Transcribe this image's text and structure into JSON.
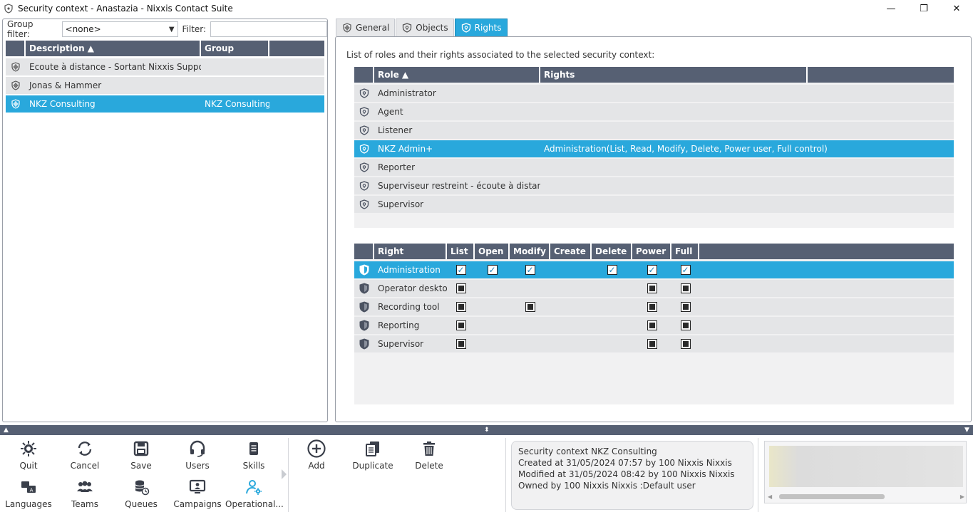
{
  "window": {
    "title": "Security context - Anastazia - Nixxis Contact Suite",
    "minimize": "—",
    "maximize": "❐",
    "close": "✕"
  },
  "left": {
    "group_filter_label": "Group filter:",
    "group_filter_value": "<none>",
    "filter_label": "Filter:",
    "filter_value": "",
    "columns": [
      "Description ▲",
      "Group"
    ],
    "rows": [
      {
        "description": "Ecoute à distance - Sortant Nixxis Support",
        "group": "",
        "selected": false
      },
      {
        "description": "Jonas & Hammer",
        "group": "",
        "selected": false
      },
      {
        "description": "NKZ Consulting",
        "group": "NKZ Consulting",
        "selected": true
      }
    ]
  },
  "tabs": [
    {
      "label": "General",
      "active": false
    },
    {
      "label": "Objects",
      "active": false
    },
    {
      "label": "Rights",
      "active": true
    }
  ],
  "rights_tab": {
    "description": "List of roles and their rights associated to the selected security context:",
    "role_columns": [
      "Role ▲",
      "Rights"
    ],
    "roles": [
      {
        "role": "Administrator",
        "rights": "",
        "selected": false
      },
      {
        "role": "Agent",
        "rights": "",
        "selected": false
      },
      {
        "role": "Listener",
        "rights": "",
        "selected": false
      },
      {
        "role": "NKZ Admin+",
        "rights": "Administration(List, Read, Modify, Delete, Power user, Full control)",
        "selected": true
      },
      {
        "role": "Reporter",
        "rights": "",
        "selected": false
      },
      {
        "role": "Superviseur restreint - écoute à distance",
        "rights": "",
        "selected": false
      },
      {
        "role": "Supervisor",
        "rights": "",
        "selected": false
      }
    ],
    "right_columns": [
      "Right",
      "List",
      "Open",
      "Modify",
      "Create",
      "Delete",
      "Power",
      "Full"
    ],
    "rights": [
      {
        "name": "Administration",
        "selected": true,
        "checks": [
          "checked",
          "checked",
          "checked",
          "none",
          "checked",
          "checked",
          "checked"
        ]
      },
      {
        "name": "Operator desktop",
        "selected": false,
        "checks": [
          "unchecked",
          "none",
          "none",
          "none",
          "none",
          "unchecked",
          "unchecked"
        ]
      },
      {
        "name": "Recording tool",
        "selected": false,
        "checks": [
          "unchecked",
          "none",
          "unchecked",
          "none",
          "none",
          "unchecked",
          "unchecked"
        ]
      },
      {
        "name": "Reporting",
        "selected": false,
        "checks": [
          "unchecked",
          "none",
          "none",
          "none",
          "none",
          "unchecked",
          "unchecked"
        ]
      },
      {
        "name": "Supervisor",
        "selected": false,
        "checks": [
          "unchecked",
          "none",
          "none",
          "none",
          "none",
          "unchecked",
          "unchecked"
        ]
      }
    ]
  },
  "toolbar": {
    "quit": "Quit",
    "cancel": "Cancel",
    "save": "Save",
    "users": "Users",
    "skills": "Skills",
    "languages": "Languages",
    "teams": "Teams",
    "queues": "Queues",
    "campaigns": "Campaigns",
    "operational": "Operational...",
    "add": "Add",
    "duplicate": "Duplicate",
    "delete": "Delete"
  },
  "info": {
    "line1": "Security context NKZ Consulting",
    "line2": "Created at 31/05/2024 07:57 by 100 Nixxis Nixxis",
    "line3": "Modified at 31/05/2024 08:42 by 100 Nixxis Nixxis",
    "line4": "Owned by 100 Nixxis Nixxis :Default user"
  },
  "colors": {
    "accent": "#29a8dc",
    "header": "#566073",
    "row": "#e4e5e7"
  }
}
